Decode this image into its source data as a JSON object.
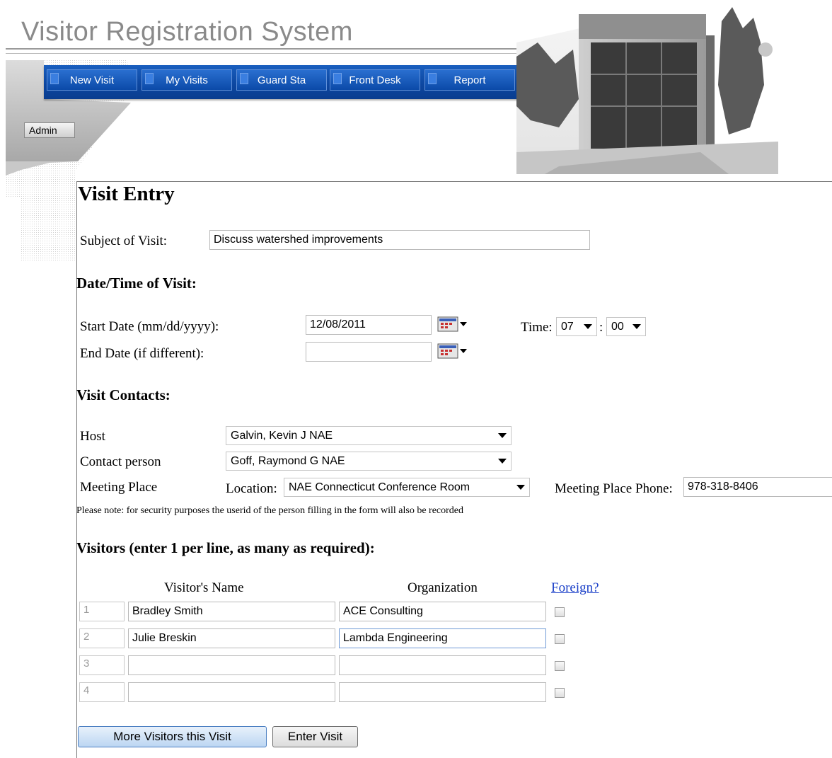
{
  "app": {
    "title": "Visitor Registration System"
  },
  "nav": {
    "items": [
      {
        "label": "New Visit"
      },
      {
        "label": "My Visits"
      },
      {
        "label": "Guard Sta"
      },
      {
        "label": "Front Desk"
      },
      {
        "label": "Report"
      }
    ],
    "admin_label": "Admin"
  },
  "page": {
    "title": "Visit Entry"
  },
  "subject": {
    "label": "Subject of Visit:",
    "value": "Discuss watershed improvements"
  },
  "datetime": {
    "heading": "Date/Time of Visit:",
    "start_label": "Start Date (mm/dd/yyyy):",
    "start_value": "12/08/2011",
    "end_label": "End Date (if different):",
    "end_value": "",
    "time_label": "Time:",
    "hour": "07",
    "minute": "00",
    "separator": ":"
  },
  "contacts": {
    "heading": "Visit Contacts:",
    "host_label": "Host",
    "host_value": "Galvin, Kevin J NAE",
    "contact_label": "Contact person",
    "contact_value": "Goff, Raymond G NAE",
    "meeting_label": "Meeting Place",
    "location_label": "Location:",
    "location_value": "NAE Connecticut Conference Room",
    "phone_label": "Meeting Place Phone:",
    "phone_value": "978-318-8406",
    "note": "Please note: for security purposes the userid of the person filling in the form will also be recorded"
  },
  "visitors": {
    "heading": "Visitors (enter 1 per line, as many as required):",
    "col_name": "Visitor's Name",
    "col_org": "Organization",
    "col_foreign": "Foreign?",
    "rows": [
      {
        "num": "1",
        "name": "Bradley Smith",
        "org": "ACE Consulting",
        "foreign": false
      },
      {
        "num": "2",
        "name": "Julie Breskin",
        "org": "Lambda Engineering",
        "foreign": false
      },
      {
        "num": "3",
        "name": "",
        "org": "",
        "foreign": false
      },
      {
        "num": "4",
        "name": "",
        "org": "",
        "foreign": false
      }
    ]
  },
  "buttons": {
    "more_label": "More Visitors this Visit",
    "enter_label": "Enter Visit"
  }
}
